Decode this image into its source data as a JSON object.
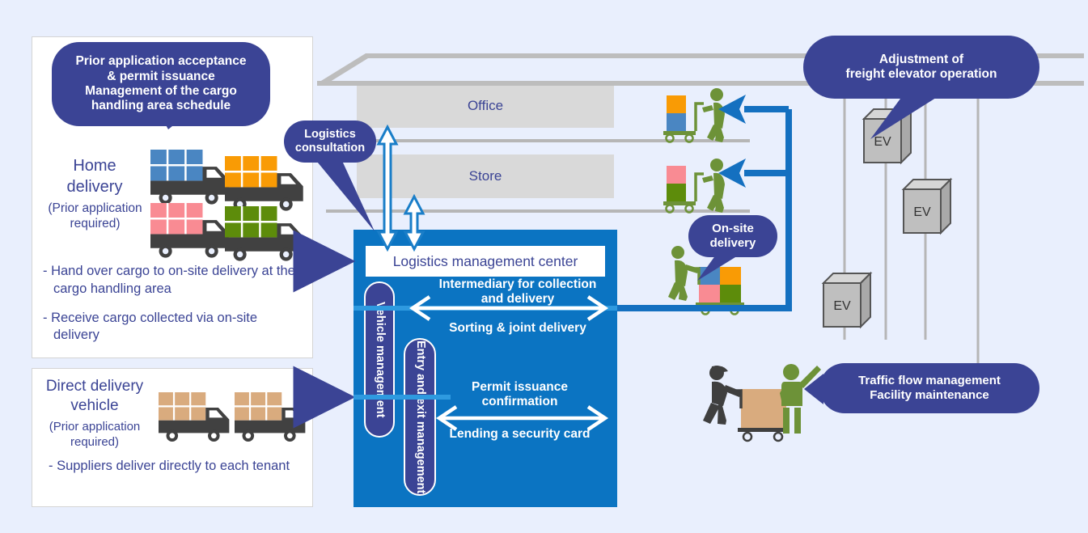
{
  "title": "Logistics management center diagram",
  "colors": {
    "background": "#e9effd",
    "navy": "#3b4495",
    "center_blue": "#0b74c2",
    "arrow_blue": "#1470c0",
    "floor_gray": "#d9d9d9",
    "line_gray": "#b6b6b6",
    "truck_body": "#414141",
    "cargo_blue": "#4a86c2",
    "cargo_orange": "#f99b05",
    "cargo_pink": "#f98b93",
    "cargo_green": "#5d8c0b",
    "cargo_tan": "#d9ab7e",
    "person_green": "#6d9238",
    "person_dark": "#3f3f3f",
    "ev_fill": "#bfbfbf",
    "ev_top": "#d6d6d6",
    "ev_side": "#a9a9a9"
  },
  "bubbles": {
    "prior_application": "Prior application acceptance\n& permit issuance\nManagement of the cargo\nhandling area schedule",
    "logistics_consultation": "Logistics\nconsultation",
    "onsite_delivery": "On-site\ndelivery",
    "freight_elevator": "Adjustment of\nfreight elevator operation",
    "traffic_flow": "Traffic flow management\nFacility maintenance"
  },
  "left_panel_home": {
    "title": "Home\ndelivery",
    "subtitle": "(Prior application\nrequired)",
    "bullets": [
      "- Hand over cargo to on-site delivery at the cargo handling area",
      "- Receive cargo collected via on-site delivery"
    ],
    "trucks": [
      {
        "cargo_color": "#4a86c2",
        "name": "truck-blue"
      },
      {
        "cargo_color": "#f99b05",
        "name": "truck-orange"
      },
      {
        "cargo_color": "#f98b93",
        "name": "truck-pink"
      },
      {
        "cargo_color": "#5d8c0b",
        "name": "truck-green"
      }
    ]
  },
  "left_panel_direct": {
    "title": "Direct delivery\nvehicle",
    "subtitle": "(Prior application\nrequired)",
    "bullets": [
      "- Suppliers deliver directly to each tenant"
    ],
    "trucks": [
      {
        "cargo_color": "#d9ab7e",
        "name": "truck-tan-1"
      },
      {
        "cargo_color": "#d9ab7e",
        "name": "truck-tan-2"
      }
    ]
  },
  "building": {
    "floors": [
      {
        "label": "Office"
      },
      {
        "label": "Store"
      }
    ]
  },
  "center": {
    "heading": "Logistics management center",
    "vertical_pills": [
      {
        "label": "Vehicle management"
      },
      {
        "label": "Entry and exit management"
      }
    ],
    "flows": [
      {
        "above": "Intermediary for collection and delivery",
        "below": "Sorting & joint delivery"
      },
      {
        "above": "Permit issuance confirmation",
        "below": "Lending a security card"
      }
    ]
  },
  "elevators": [
    {
      "label": "EV"
    },
    {
      "label": "EV"
    },
    {
      "label": "EV"
    }
  ]
}
